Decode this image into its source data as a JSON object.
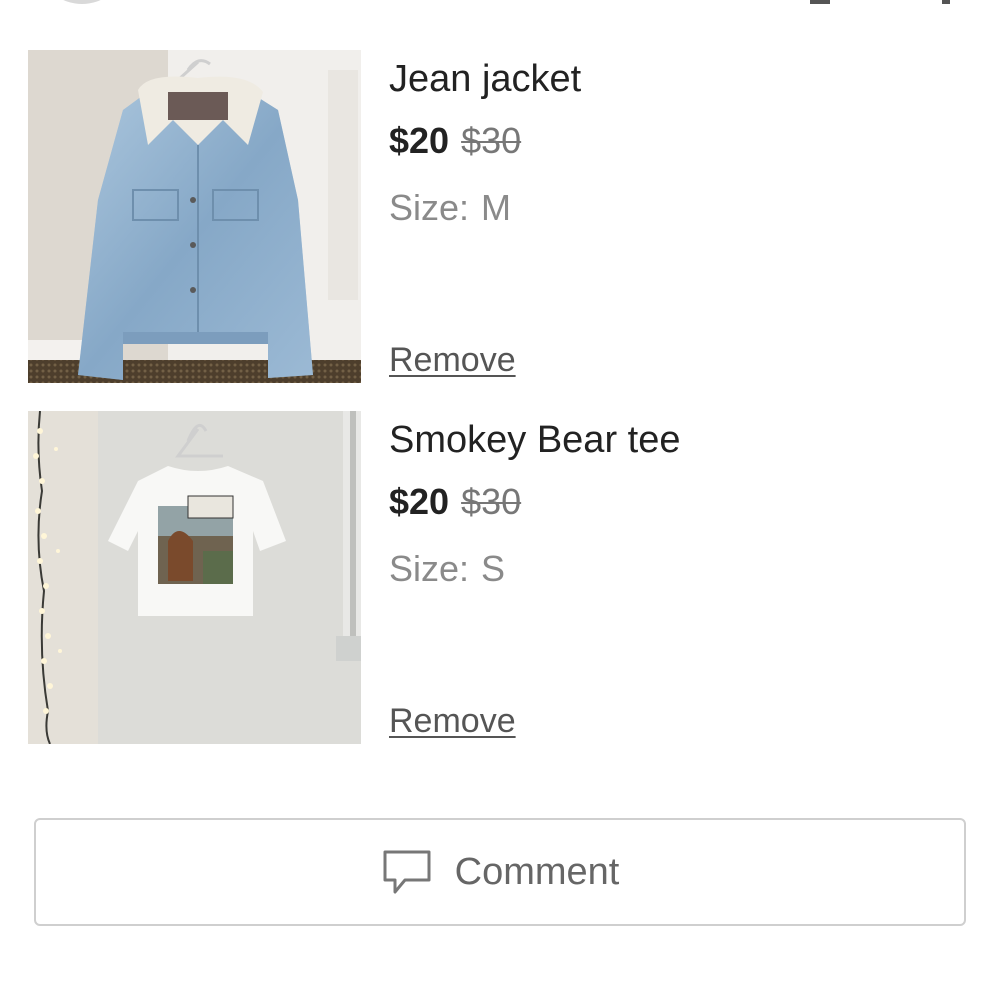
{
  "cart": {
    "items": [
      {
        "title": "Jean jacket",
        "price": "$20",
        "original_price": "$30",
        "size_label": "Size:",
        "size_value": "M",
        "remove_label": "Remove",
        "image_icon": "jean-jacket-photo"
      },
      {
        "title": "Smokey Bear tee",
        "price": "$20",
        "original_price": "$30",
        "size_label": "Size:",
        "size_value": "S",
        "remove_label": "Remove",
        "image_icon": "t-shirt-photo"
      }
    ]
  },
  "comment_button": {
    "label": "Comment",
    "icon": "speech-bubble-icon"
  }
}
